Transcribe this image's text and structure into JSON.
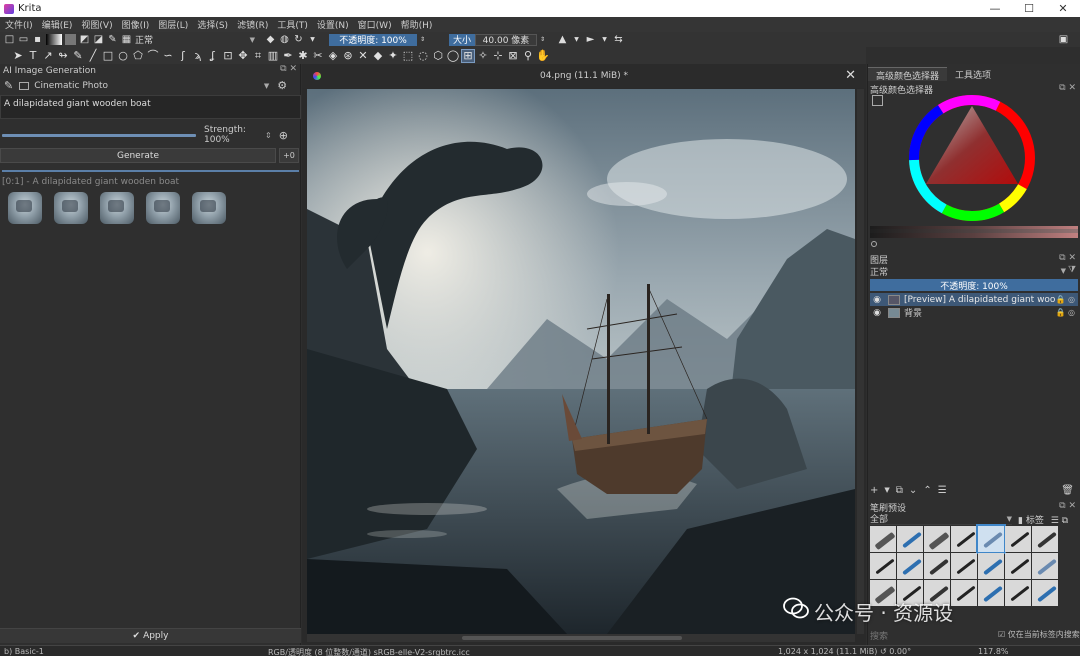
{
  "window": {
    "app_title": "Krita",
    "minimize": "—",
    "maximize": "☐",
    "close": "✕"
  },
  "menu": [
    "文件(I)",
    "编辑(E)",
    "视图(V)",
    "图像(I)",
    "图层(L)",
    "选择(S)",
    "滤镜(R)",
    "工具(T)",
    "设置(N)",
    "窗口(W)",
    "帮助(H)"
  ],
  "toolbar": {
    "blend_mode": "正常",
    "opacity_label": "不透明度: 100%",
    "size_label": "大小",
    "size_value": "40.00 像素"
  },
  "ai_panel": {
    "title": "AI Image Generation",
    "style": "Cinematic Photo",
    "prompt": "A dilapidated giant wooden boat",
    "strength": "Strength: 100%",
    "generate": "Generate",
    "queue": "+0",
    "history_label": "[0:1] - A dilapidated giant wooden boat",
    "apply": "Apply"
  },
  "canvas": {
    "doc_title": "04.png (11.1 MiB) *"
  },
  "right": {
    "tabs": [
      "高级颜色选择器",
      "工具选项"
    ],
    "color_title": "高级颜色选择器",
    "layers_title": "图层",
    "blend": "正常",
    "opacity": "不透明度: 100%",
    "layers": [
      {
        "name": "[Preview] A dilapidated giant wood…",
        "selected": true
      },
      {
        "name": "背景",
        "selected": false
      }
    ],
    "brush_title": "笔刷预设",
    "brush_filter": "全部",
    "brush_tag": "标签",
    "brush_search": "搜索",
    "brush_check": "仅在当前标签内搜索"
  },
  "status": {
    "brush": "b) Basic-1",
    "color": "RGB/透明度 (8 位整数/通道)  sRGB-elle-V2-srgbtrc.icc",
    "size": "1,024 x 1,024 (11.1 MiB)",
    "rotation": "0.00°",
    "zoom": "117.8%"
  },
  "watermark": "公众号 · 资源设",
  "colors": {
    "accent": "#3f6d9e",
    "selected_layer": "#3d5877",
    "panel": "#2f2f2f"
  }
}
